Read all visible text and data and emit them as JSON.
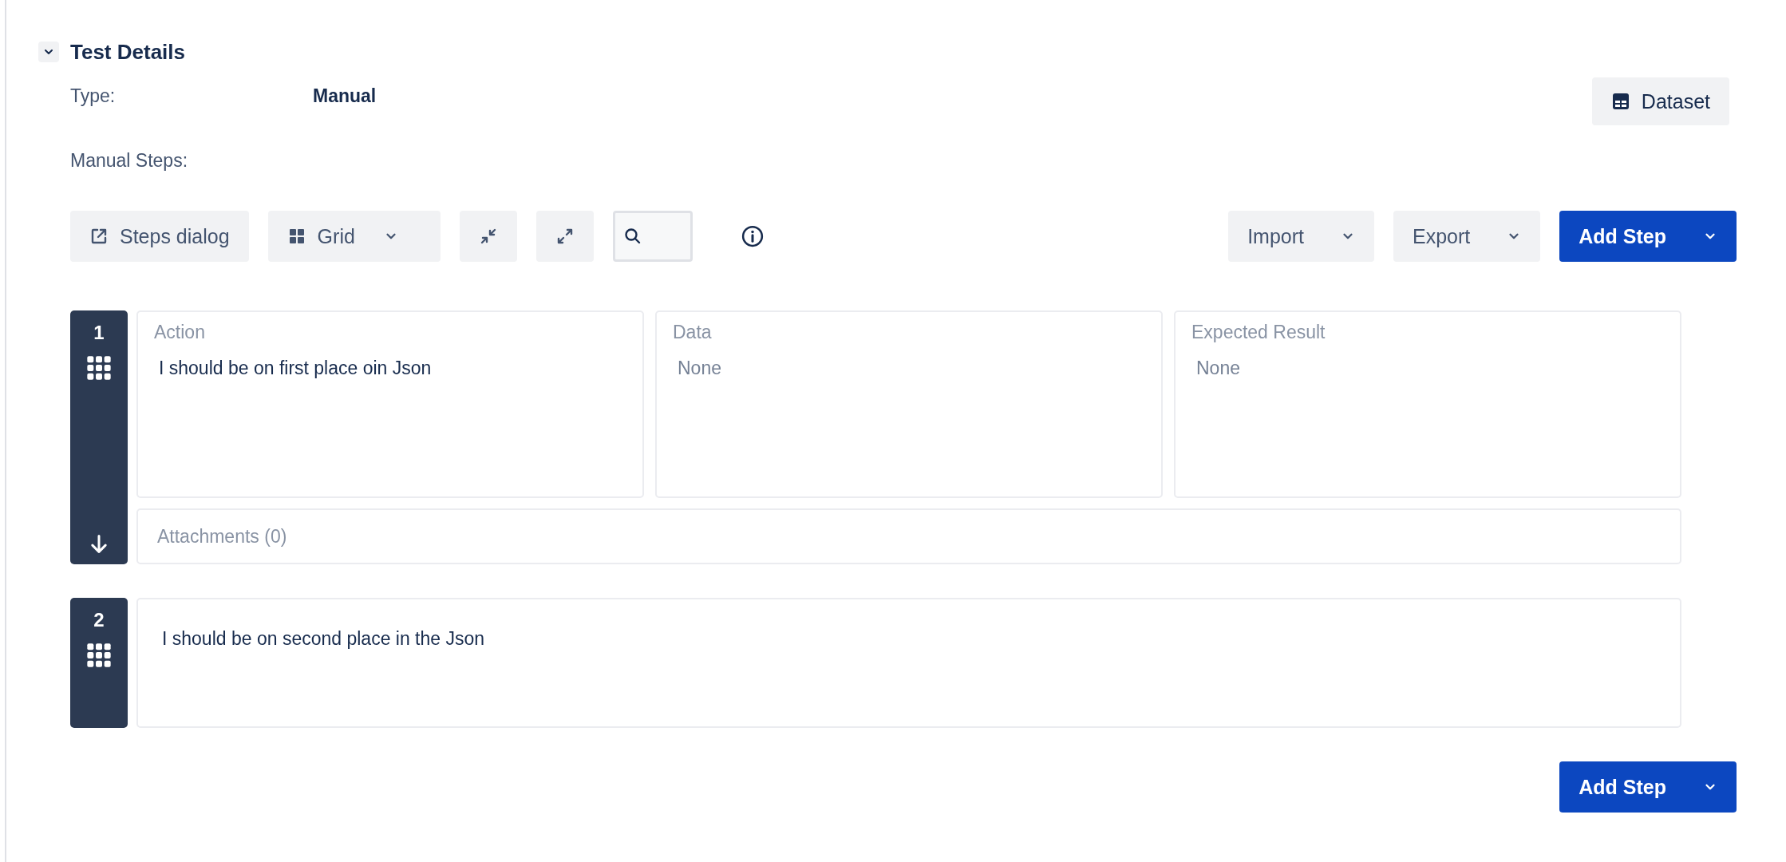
{
  "section": {
    "title": "Test Details",
    "expanded": true
  },
  "type": {
    "label": "Type:",
    "value": "Manual"
  },
  "dataset_button": {
    "label": "Dataset"
  },
  "manual_steps_label": "Manual Steps:",
  "toolbar": {
    "left": [
      {
        "kind": "steps_dialog",
        "label": "Steps dialog"
      },
      {
        "kind": "view_select",
        "label": "Grid"
      },
      {
        "kind": "collapse"
      },
      {
        "kind": "expand"
      },
      {
        "kind": "search"
      },
      {
        "kind": "info"
      }
    ],
    "right": [
      {
        "kind": "dropdown",
        "label": "Import"
      },
      {
        "kind": "dropdown",
        "label": "Export"
      },
      {
        "kind": "primary_dropdown",
        "label": "Add Step"
      }
    ]
  },
  "steps": [
    {
      "number": "1",
      "kind": "expanded",
      "fields": [
        {
          "label": "Action",
          "value": "I should be on first place oin Json",
          "empty": false
        },
        {
          "label": "Data",
          "value": "None",
          "empty": true
        },
        {
          "label": "Expected Result",
          "value": "None",
          "empty": true
        }
      ],
      "attachments": "Attachments (0)"
    },
    {
      "number": "2",
      "kind": "collapsed",
      "action": "I should be on second place in the Json"
    }
  ],
  "footer_button": {
    "label": "Add Step"
  }
}
